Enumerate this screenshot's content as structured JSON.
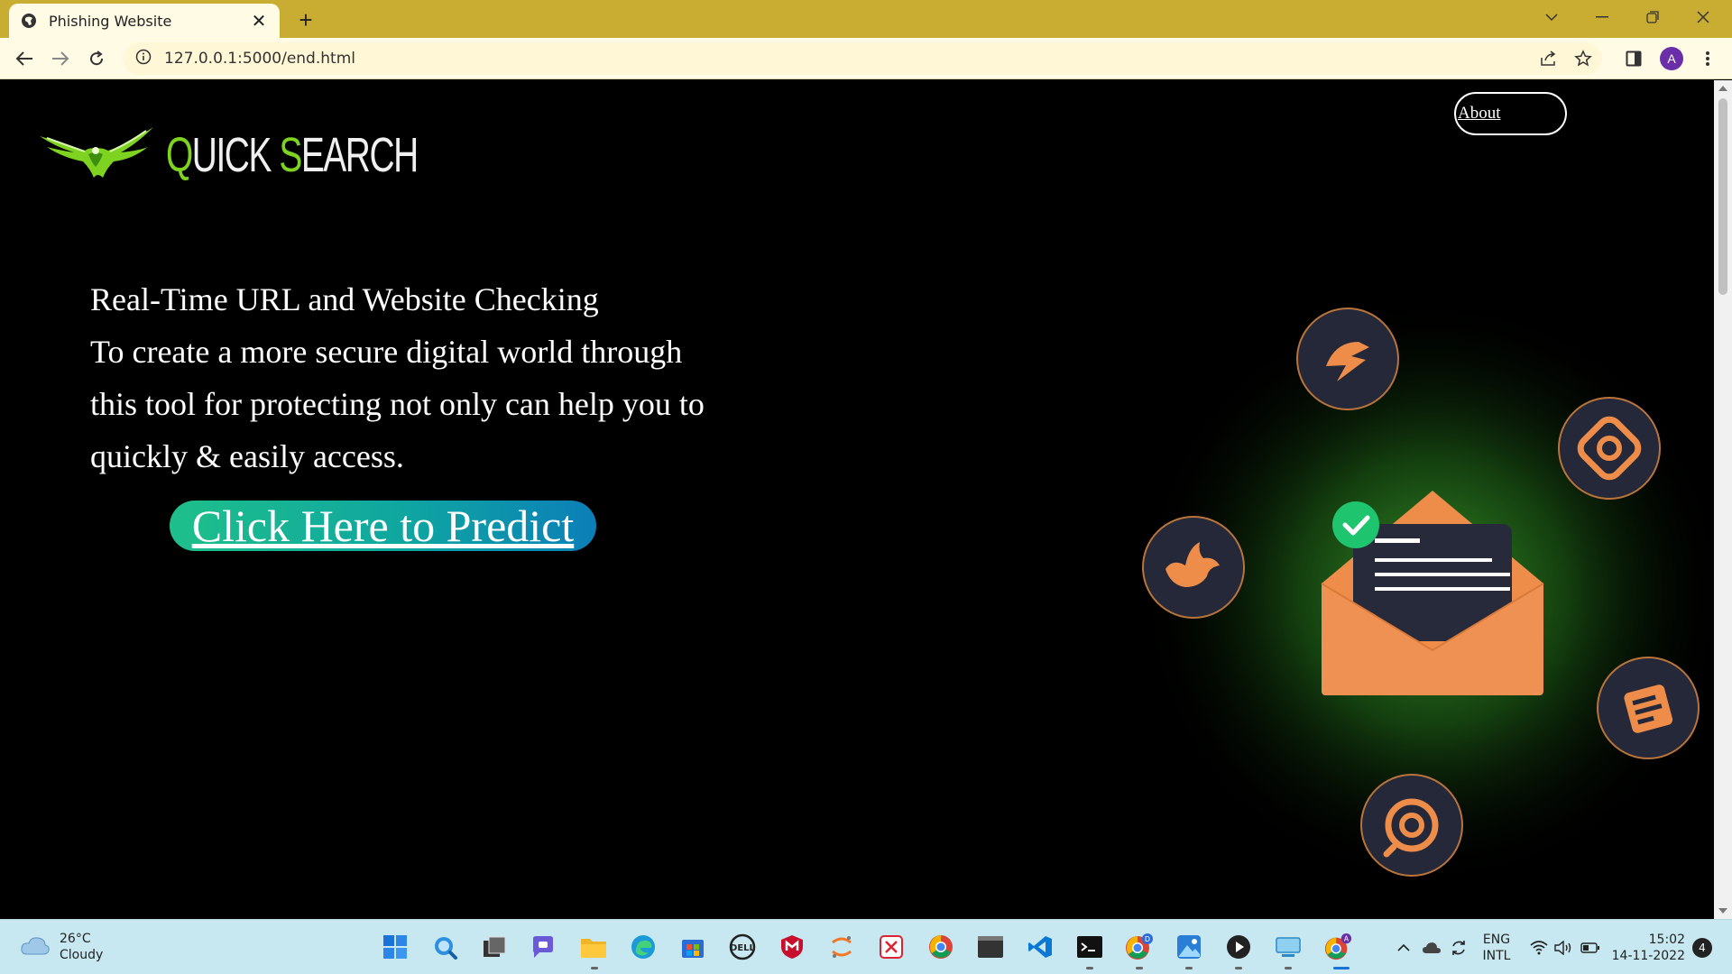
{
  "browser": {
    "tab_title": "Phishing Website",
    "url": "127.0.0.1:5000/end.html",
    "profile_initial": "A"
  },
  "page": {
    "logo_text_q": "Q",
    "logo_text_uick": "UICK ",
    "logo_text_s": "S",
    "logo_text_earch": "EARCH",
    "about_label": "About",
    "hero_lines": [
      "Real-Time URL and Website Checking",
      "To create a more secure digital world through",
      "this tool for protecting not only can help you to",
      "quickly & easily access."
    ],
    "predict_label": "Click Here to Predict"
  },
  "taskbar": {
    "weather_temp": "26°C",
    "weather_desc": "Cloudy",
    "lang_top": "ENG",
    "lang_bottom": "INTL",
    "time": "15:02",
    "date": "14-11-2022",
    "notification_count": "4"
  },
  "colors": {
    "tab_bar": "#c9ad32",
    "toolbar": "#fffbe5",
    "page_bg": "#000000",
    "accent_green": "#7ed321",
    "envelope_orange": "#ee8d4a",
    "taskbar": "#c7e8f0"
  }
}
